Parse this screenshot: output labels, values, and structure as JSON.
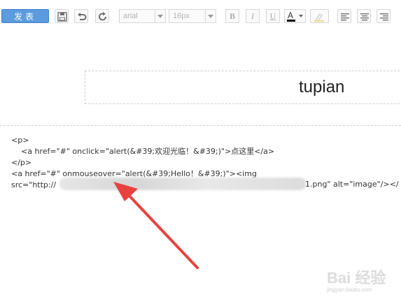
{
  "toolbar": {
    "publish_label": "发表",
    "font_family": "arial",
    "font_size": "16px",
    "bold": "B",
    "italic": "I",
    "underline": "U",
    "font_color": "A",
    "font_color_value": "#000000"
  },
  "title": {
    "text": "tupian"
  },
  "code_lines": [
    "<p>",
    "    <a href=\"#\" onclick=\"alert(&#39;欢迎光临！&#39;)\">点这里</a>",
    "</p>",
    "<a href=\"#\" onmouseover=\"alert(&#39;Hello！&#39;)\"><img",
    "src=\"http://"
  ],
  "code_tail": "1.png\" alt=\"image\"/></",
  "watermark": {
    "logo": "Bai 经验",
    "sub": "jingyan.baidu.com"
  },
  "colors": {
    "accent": "#5b9bde",
    "arrow": "#e8423e"
  }
}
